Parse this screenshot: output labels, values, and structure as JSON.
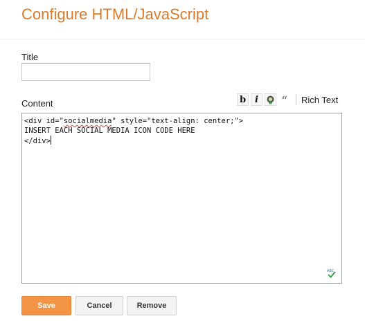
{
  "page": {
    "title": "Configure HTML/JavaScript"
  },
  "form": {
    "title_label": "Title",
    "title_value": "",
    "content_label": "Content",
    "content_lines": [
      {
        "before": "<div id=\"",
        "squiggle": "socialmedia",
        "after": "\" style=\"text-align: center;\">"
      },
      {
        "text": "INSERT EACH SOCIAL MEDIA ICON CODE HERE"
      },
      {
        "text": "</div>"
      }
    ]
  },
  "toolbar": {
    "bold_label": "b",
    "italic_label": "i",
    "quote_label": "“",
    "rich_text_label": "Rich Text",
    "icons": [
      "bold-icon",
      "italic-icon",
      "link-icon",
      "quote-icon",
      "spellcheck-icon"
    ]
  },
  "buttons": {
    "save": "Save",
    "cancel": "Cancel",
    "remove": "Remove"
  },
  "colors": {
    "title": "#dd7b2c",
    "save_button": "#f39344"
  }
}
